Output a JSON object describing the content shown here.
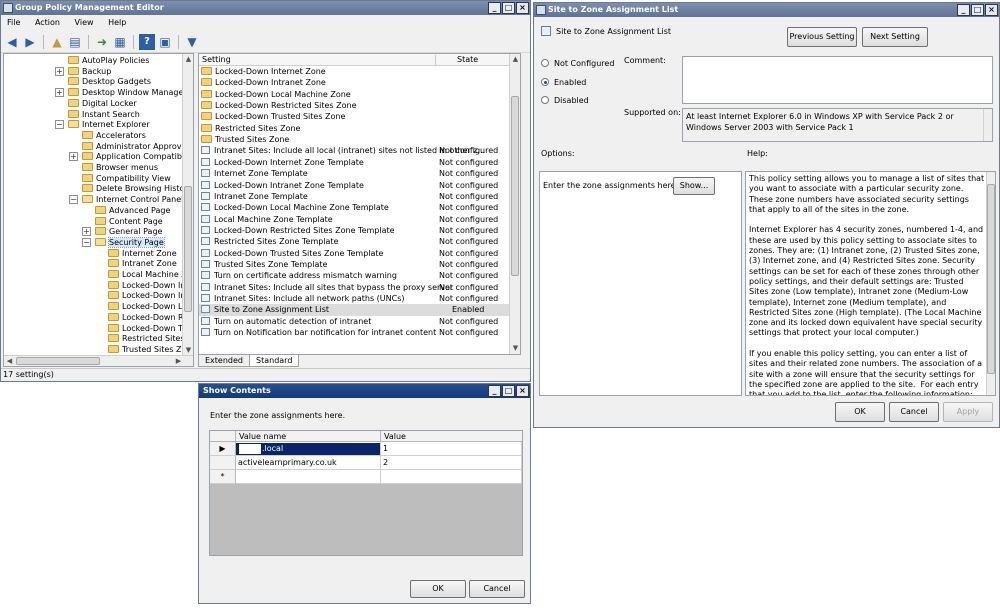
{
  "gpme": {
    "title": "Group Policy Management Editor",
    "menu": [
      "File",
      "Action",
      "View",
      "Help"
    ],
    "tree": [
      {
        "label": "AutoPlay Policies",
        "indent": 0,
        "expander": ""
      },
      {
        "label": "Backup",
        "indent": 0,
        "expander": "+"
      },
      {
        "label": "Desktop Gadgets",
        "indent": 0,
        "expander": ""
      },
      {
        "label": "Desktop Window Manager",
        "indent": 0,
        "expander": "+"
      },
      {
        "label": "Digital Locker",
        "indent": 0,
        "expander": ""
      },
      {
        "label": "Instant Search",
        "indent": 0,
        "expander": ""
      },
      {
        "label": "Internet Explorer",
        "indent": 0,
        "expander": "-"
      },
      {
        "label": "Accelerators",
        "indent": 1,
        "expander": ""
      },
      {
        "label": "Administrator Approved Co",
        "indent": 1,
        "expander": ""
      },
      {
        "label": "Application Compatibility",
        "indent": 1,
        "expander": "+"
      },
      {
        "label": "Browser menus",
        "indent": 1,
        "expander": ""
      },
      {
        "label": "Compatibility View",
        "indent": 1,
        "expander": ""
      },
      {
        "label": "Delete Browsing History",
        "indent": 1,
        "expander": ""
      },
      {
        "label": "Internet Control Panel",
        "indent": 1,
        "expander": "-"
      },
      {
        "label": "Advanced Page",
        "indent": 2,
        "expander": ""
      },
      {
        "label": "Content Page",
        "indent": 2,
        "expander": ""
      },
      {
        "label": "General Page",
        "indent": 2,
        "expander": "+"
      },
      {
        "label": "Security Page",
        "indent": 2,
        "expander": "-",
        "selected": true
      },
      {
        "label": "Internet Zone",
        "indent": 3,
        "expander": ""
      },
      {
        "label": "Intranet Zone",
        "indent": 3,
        "expander": ""
      },
      {
        "label": "Local Machine Zone",
        "indent": 3,
        "expander": ""
      },
      {
        "label": "Locked-Down Intern",
        "indent": 3,
        "expander": ""
      },
      {
        "label": "Locked-Down Intran",
        "indent": 3,
        "expander": ""
      },
      {
        "label": "Locked-Down Local",
        "indent": 3,
        "expander": ""
      },
      {
        "label": "Locked-Down Restri",
        "indent": 3,
        "expander": ""
      },
      {
        "label": "Locked-Down Truste",
        "indent": 3,
        "expander": ""
      },
      {
        "label": "Restricted Sites Zor",
        "indent": 3,
        "expander": ""
      },
      {
        "label": "Trusted Sites Zone",
        "indent": 3,
        "expander": ""
      }
    ],
    "columns": {
      "setting": "Setting",
      "state": "State"
    },
    "settings": [
      {
        "name": "Locked-Down Internet Zone",
        "state": "",
        "folder": true
      },
      {
        "name": "Locked-Down Intranet Zone",
        "state": "",
        "folder": true
      },
      {
        "name": "Locked-Down Local Machine Zone",
        "state": "",
        "folder": true
      },
      {
        "name": "Locked-Down Restricted Sites Zone",
        "state": "",
        "folder": true
      },
      {
        "name": "Locked-Down Trusted Sites Zone",
        "state": "",
        "folder": true
      },
      {
        "name": "Restricted Sites Zone",
        "state": "",
        "folder": true
      },
      {
        "name": "Trusted Sites Zone",
        "state": "",
        "folder": true
      },
      {
        "name": "Intranet Sites: Include all local (intranet) sites not listed in other z...",
        "state": "Not configured"
      },
      {
        "name": "Locked-Down Internet Zone Template",
        "state": "Not configured"
      },
      {
        "name": "Internet Zone Template",
        "state": "Not configured"
      },
      {
        "name": "Locked-Down Intranet Zone Template",
        "state": "Not configured"
      },
      {
        "name": "Intranet Zone Template",
        "state": "Not configured"
      },
      {
        "name": "Locked-Down Local Machine Zone Template",
        "state": "Not configured"
      },
      {
        "name": "Local Machine Zone Template",
        "state": "Not configured"
      },
      {
        "name": "Locked-Down Restricted Sites Zone Template",
        "state": "Not configured"
      },
      {
        "name": "Restricted Sites Zone Template",
        "state": "Not configured"
      },
      {
        "name": "Locked-Down Trusted Sites Zone Template",
        "state": "Not configured"
      },
      {
        "name": "Trusted Sites Zone Template",
        "state": "Not configured"
      },
      {
        "name": "Turn on certificate address mismatch warning",
        "state": "Not configured"
      },
      {
        "name": "Intranet Sites: Include all sites that bypass the proxy server",
        "state": "Not configured"
      },
      {
        "name": "Intranet Sites: Include all network paths (UNCs)",
        "state": "Not configured"
      },
      {
        "name": "Site to Zone Assignment List",
        "state": "Enabled",
        "selected": true
      },
      {
        "name": "Turn on automatic detection of intranet",
        "state": "Not configured"
      },
      {
        "name": "Turn on Notification bar notification for intranet content",
        "state": "Not configured"
      }
    ],
    "tabs": [
      "Extended",
      "Standard"
    ],
    "status": "17 setting(s)"
  },
  "policy": {
    "title": "Site to Zone Assignment List",
    "header": "Site to Zone Assignment List",
    "prev_button": "Previous Setting",
    "next_button": "Next Setting",
    "radio_not_configured": "Not Configured",
    "radio_enabled": "Enabled",
    "radio_disabled": "Disabled",
    "comment_label": "Comment:",
    "supported_label": "Supported on:",
    "supported_text": "At least Internet Explorer 6.0 in Windows XP with Service Pack 2 or Windows Server 2003 with Service Pack 1",
    "options_label": "Options:",
    "help_label": "Help:",
    "options_text": "Enter the zone assignments here.",
    "show_button": "Show...",
    "help_text": "This policy setting allows you to manage a list of sites that you want to associate with a particular security zone. These zone numbers have associated security settings that apply to all of the sites in the zone.\n\nInternet Explorer has 4 security zones, numbered 1-4, and these are used by this policy setting to associate sites to zones. They are: (1) Intranet zone, (2) Trusted Sites zone, (3) Internet zone, and (4) Restricted Sites zone. Security settings can be set for each of these zones through other policy settings, and their default settings are: Trusted Sites zone (Low template), Intranet zone (Medium-Low template), Internet zone (Medium template), and Restricted Sites zone (High template). (The Local Machine zone and its locked down equivalent have special security settings that protect your local computer.)\n\nIf you enable this policy setting, you can enter a list of sites and their related zone numbers. The association of a site with a zone will ensure that the security settings for the specified zone are applied to the site.  For each entry that you add to the list, enter the following information:",
    "ok": "OK",
    "cancel": "Cancel",
    "apply": "Apply"
  },
  "show": {
    "title": "Show Contents",
    "instructions": "Enter the zone assignments here.",
    "col_name": "Value name",
    "col_value": "Value",
    "rows": [
      {
        "name": ".local",
        "value": "1"
      },
      {
        "name": "activelearnprimary.co.uk",
        "value": "2"
      }
    ],
    "new_row_marker": "*",
    "ok": "OK",
    "cancel": "Cancel"
  }
}
